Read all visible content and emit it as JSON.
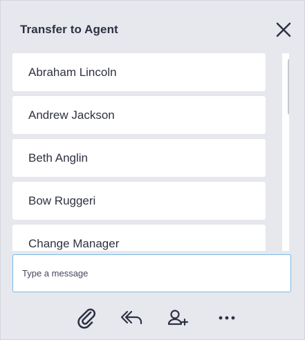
{
  "header": {
    "title": "Transfer to Agent",
    "close_icon": "close-icon"
  },
  "agents": [
    {
      "name": "Abraham Lincoln"
    },
    {
      "name": "Andrew Jackson"
    },
    {
      "name": "Beth Anglin"
    },
    {
      "name": "Bow Ruggeri"
    },
    {
      "name": "Change Manager"
    }
  ],
  "composer": {
    "placeholder": "Type a message",
    "value": ""
  },
  "toolbar": {
    "icons": [
      "paperclip-icon",
      "reply-all-icon",
      "add-user-icon",
      "more-icon"
    ]
  },
  "colors": {
    "panel_bg": "#e6e8ee",
    "input_border": "#76b8e9",
    "text": "#2e3240"
  }
}
